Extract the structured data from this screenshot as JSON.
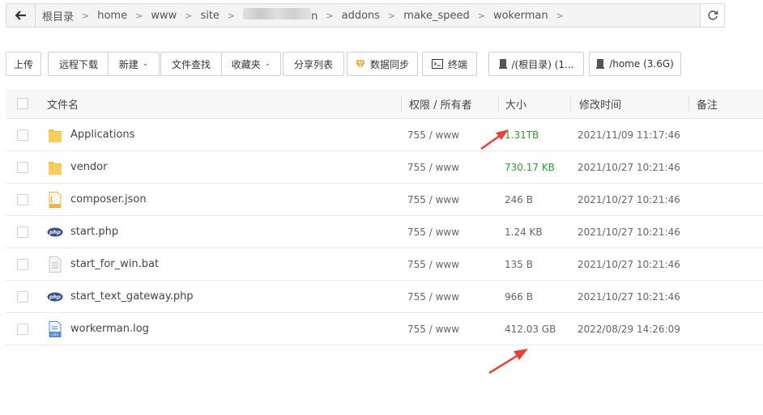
{
  "breadcrumb": {
    "items": [
      "根目录",
      "home",
      "www",
      "site",
      "",
      "addons",
      "make_speed",
      "wokerman"
    ],
    "redacted_fragment": "n"
  },
  "toolbar": {
    "upload": "上传",
    "remote_download": "远程下载",
    "new": "新建",
    "file_search": "文件查找",
    "favorites": "收藏夹",
    "share_list": "分享列表",
    "data_sync": "数据同步",
    "terminal": "终端",
    "disk_root": "/(根目录) (1...",
    "disk_home": "/home (3.6G)"
  },
  "table": {
    "headers": {
      "name": "文件名",
      "perm": "权限 / 所有者",
      "size": "大小",
      "mtime": "修改时间",
      "note": "备注"
    },
    "rows": [
      {
        "name": "Applications",
        "perm": "755 / www",
        "size": "1.31TB",
        "mtime": "2021/11/09 11:17:46",
        "icon": "folder-icon",
        "size_color": "#2e9d2e"
      },
      {
        "name": "vendor",
        "perm": "755 / www",
        "size": "730.17 KB",
        "mtime": "2021/10/27 10:21:46",
        "icon": "folder-icon",
        "size_color": "#2e9d2e"
      },
      {
        "name": "composer.json",
        "perm": "755 / www",
        "size": "246 B",
        "mtime": "2021/10/27 10:21:46",
        "icon": "json-file-icon",
        "size_color": "#666666"
      },
      {
        "name": "start.php",
        "perm": "755 / www",
        "size": "1.24 KB",
        "mtime": "2021/10/27 10:21:46",
        "icon": "php-file-icon",
        "size_color": "#666666"
      },
      {
        "name": "start_for_win.bat",
        "perm": "755 / www",
        "size": "135 B",
        "mtime": "2021/10/27 10:21:46",
        "icon": "text-file-icon",
        "size_color": "#666666"
      },
      {
        "name": "start_text_gateway.php",
        "perm": "755 / www",
        "size": "966 B",
        "mtime": "2021/10/27 10:21:46",
        "icon": "php-file-icon",
        "size_color": "#666666"
      },
      {
        "name": "workerman.log",
        "perm": "755 / www",
        "size": "412.03 GB",
        "mtime": "2022/08/29 14:26:09",
        "icon": "log-file-icon",
        "size_color": "#666666"
      }
    ]
  },
  "colors": {
    "accent_green": "#2e9d2e",
    "annotation_red": "#e8433a"
  }
}
